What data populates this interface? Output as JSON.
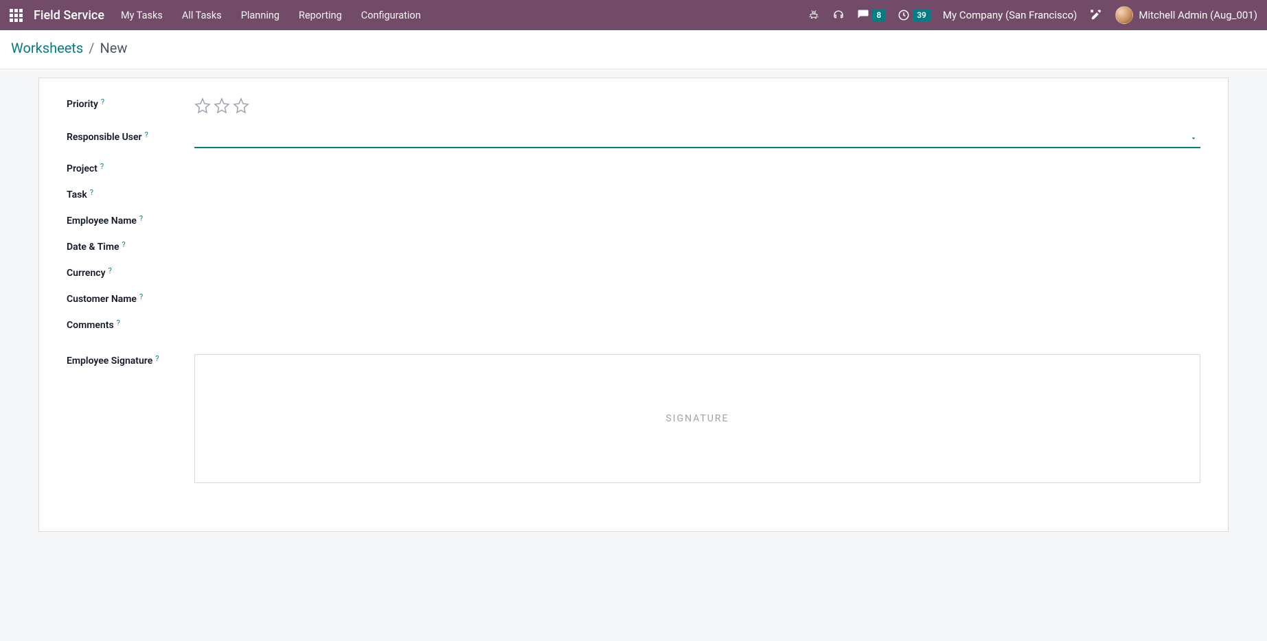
{
  "navbar": {
    "brand": "Field Service",
    "menu": [
      "My Tasks",
      "All Tasks",
      "Planning",
      "Reporting",
      "Configuration"
    ],
    "messages_count": "8",
    "activities_count": "39",
    "company": "My Company (San Francisco)",
    "user": "Mitchell Admin (Aug_001)"
  },
  "breadcrumb": {
    "parent": "Worksheets",
    "current": "New"
  },
  "form": {
    "labels": {
      "priority": "Priority",
      "responsible_user": "Responsible User",
      "project": "Project",
      "task": "Task",
      "employee_name": "Employee Name",
      "date_time": "Date & Time",
      "currency": "Currency",
      "customer_name": "Customer Name",
      "comments": "Comments",
      "employee_signature": "Employee Signature"
    },
    "values": {
      "responsible_user": ""
    },
    "signature_placeholder": "SIGNATURE",
    "help_marker": "?"
  }
}
